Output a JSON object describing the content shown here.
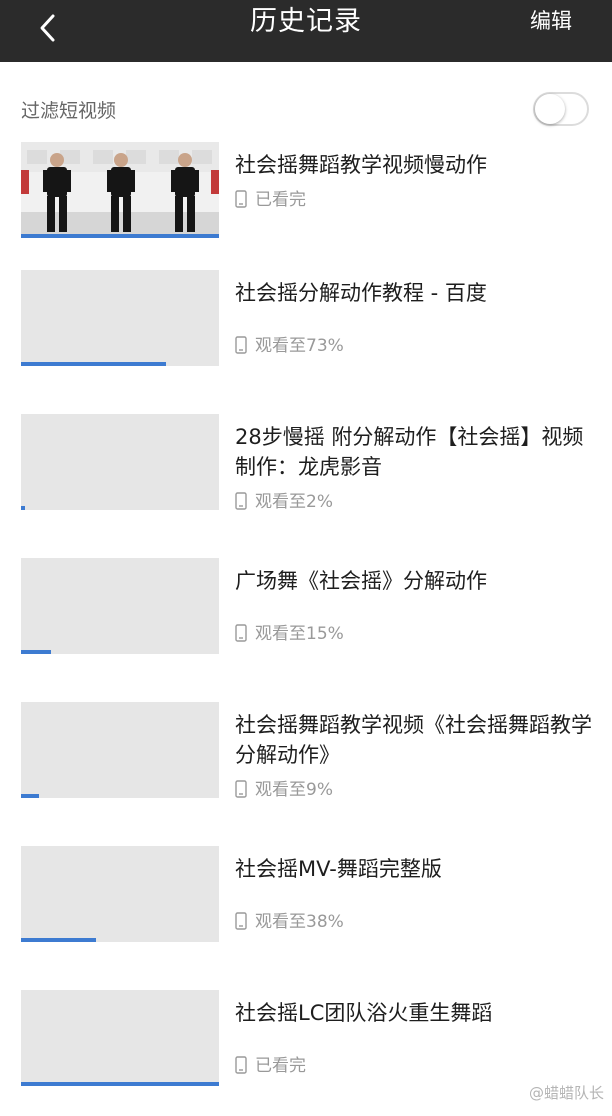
{
  "header": {
    "title": "历史记录",
    "edit_label": "编辑",
    "back_icon": "chevron-left-icon"
  },
  "filter": {
    "label": "过滤短视频",
    "toggle_on": false
  },
  "colors": {
    "header_bg": "#2b2b2b",
    "progress": "#3d7bd1",
    "thumb_placeholder": "#e6e6e6"
  },
  "history": [
    {
      "title": "社会摇舞蹈教学视频慢动作",
      "status": "已看完",
      "progress": 1.0,
      "thumbnail": "dancers"
    },
    {
      "title": "社会摇分解动作教程 - 百度",
      "status": "观看至73%",
      "progress": 0.73,
      "thumbnail": "placeholder"
    },
    {
      "title": "28步慢摇 附分解动作【社会摇】视频制作：龙虎影音",
      "status": "观看至2%",
      "progress": 0.02,
      "thumbnail": "placeholder"
    },
    {
      "title": "广场舞《社会摇》分解动作",
      "status": "观看至15%",
      "progress": 0.15,
      "thumbnail": "placeholder"
    },
    {
      "title": "社会摇舞蹈教学视频《社会摇舞蹈教学分解动作》",
      "status": "观看至9%",
      "progress": 0.09,
      "thumbnail": "placeholder"
    },
    {
      "title": "社会摇MV-舞蹈完整版",
      "status": "观看至38%",
      "progress": 0.38,
      "thumbnail": "placeholder"
    },
    {
      "title": "社会摇LC团队浴火重生舞蹈",
      "status": "已看完",
      "progress": 1.0,
      "thumbnail": "placeholder"
    }
  ],
  "watermark": "@蜡蜡队长"
}
